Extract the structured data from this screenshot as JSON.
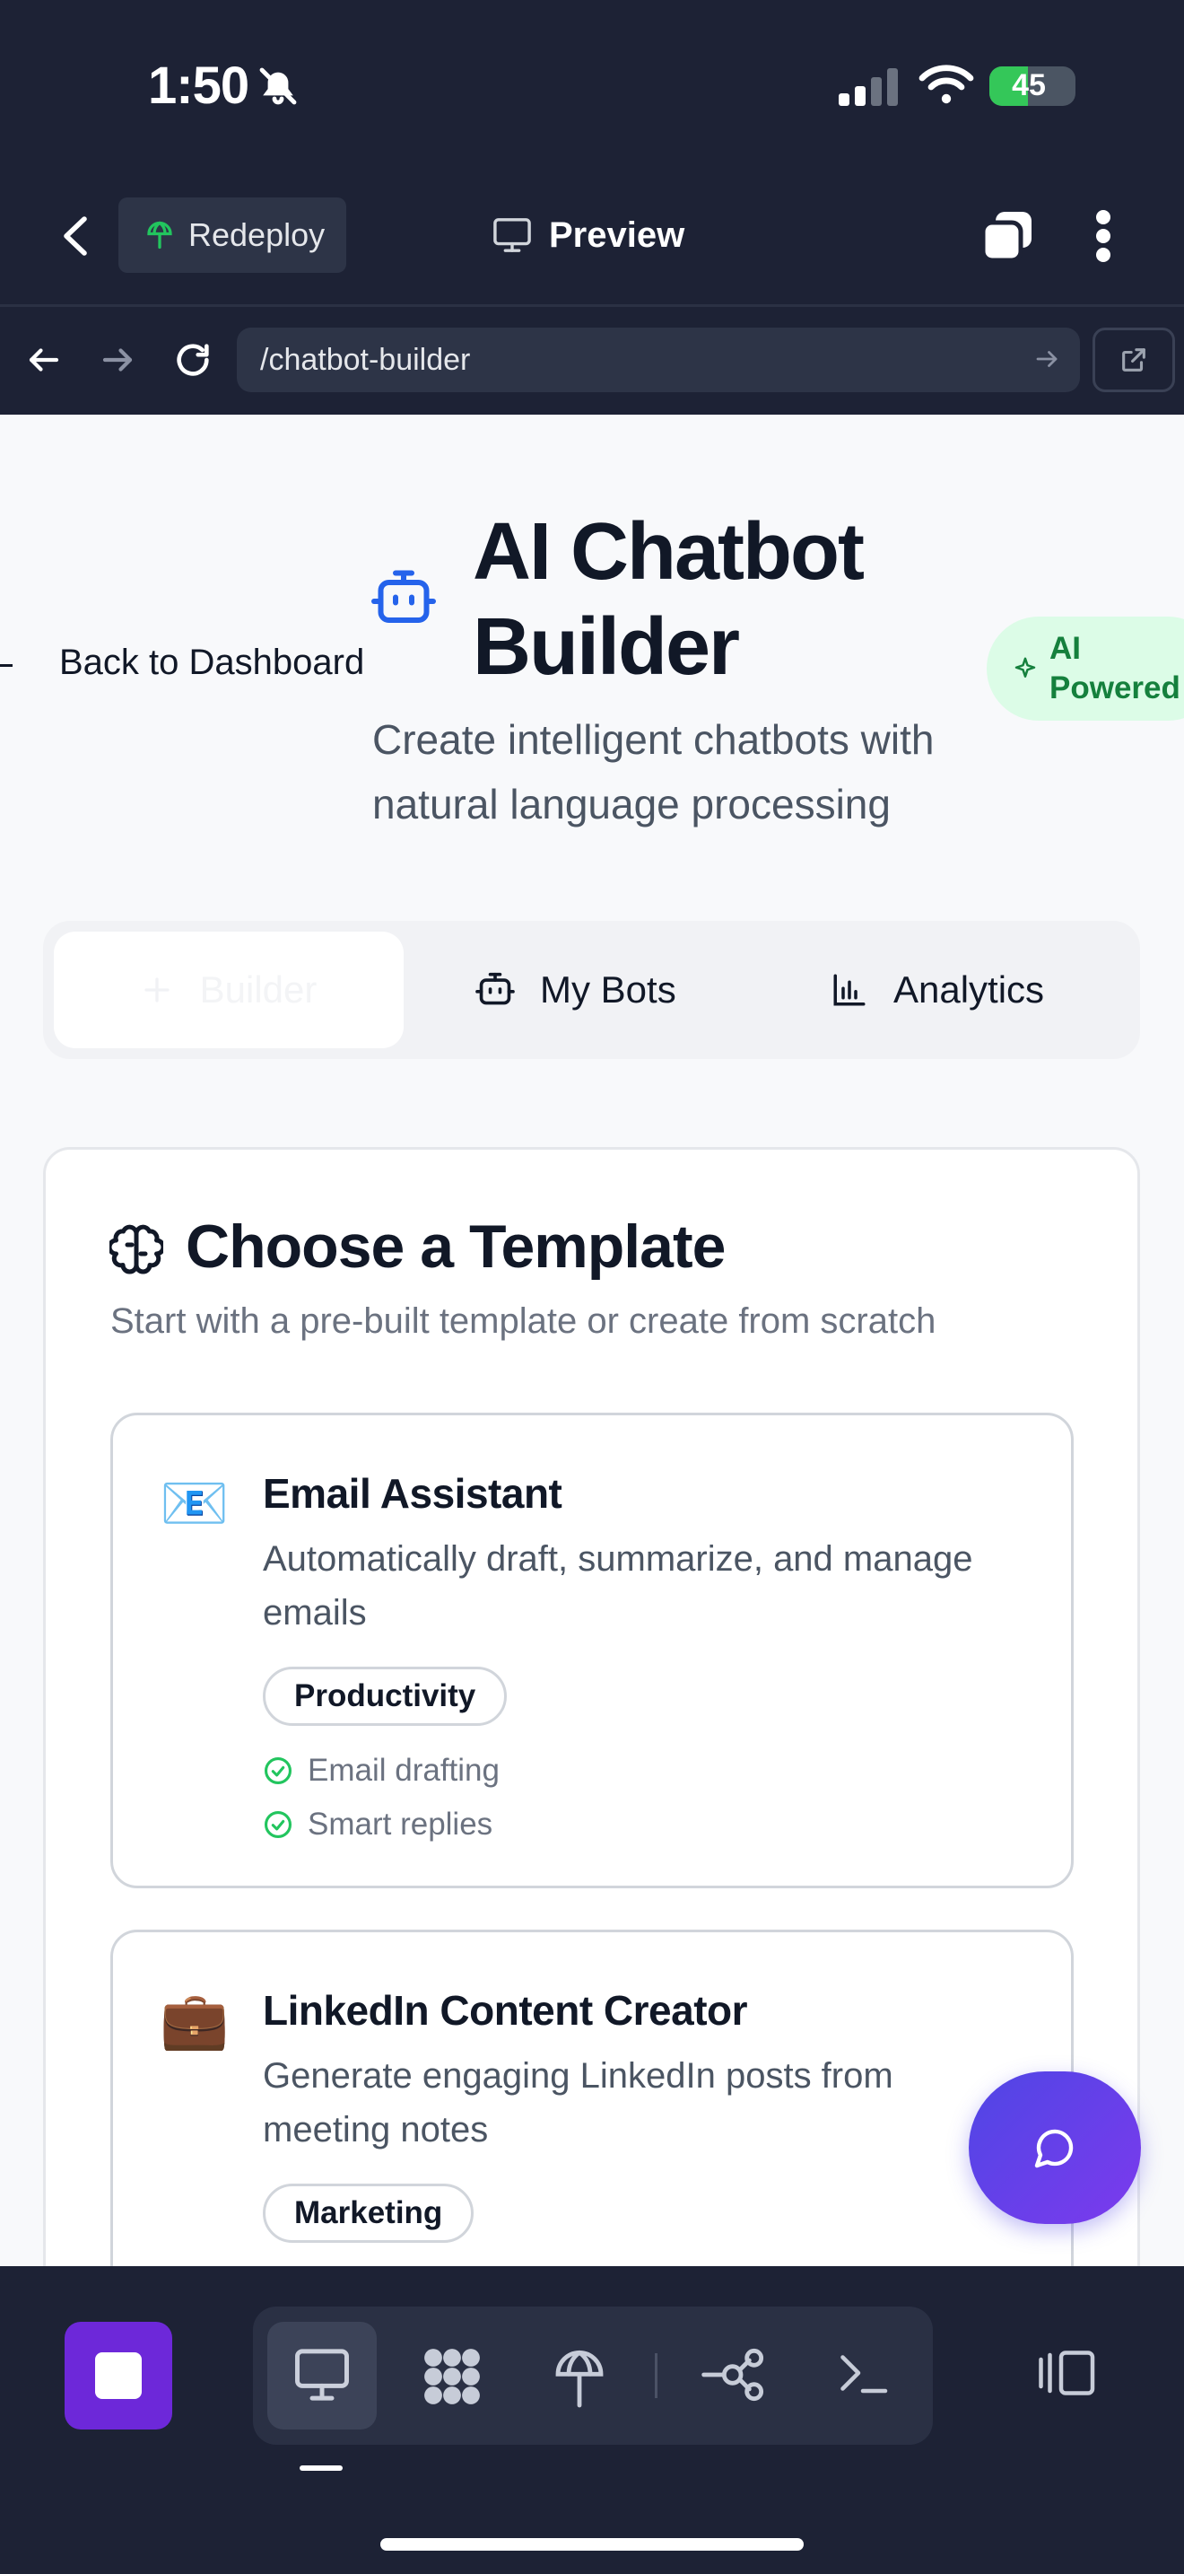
{
  "status_bar": {
    "time": "1:50",
    "battery": "45",
    "battery_level": 0.45
  },
  "top_bar": {
    "redeploy_label": "Redeploy",
    "preview_label": "Preview"
  },
  "url_bar": {
    "url": "/chatbot-builder"
  },
  "page": {
    "back_label": "Back to Dashboard",
    "title": "AI Chatbot Builder",
    "badge": "AI Powered",
    "subtitle": "Create intelligent chatbots with natural language processing",
    "tabs": [
      {
        "label": "Builder",
        "active": true
      },
      {
        "label": "My Bots",
        "active": false
      },
      {
        "label": "Analytics",
        "active": false
      }
    ],
    "section": {
      "title": "Choose a Template",
      "subtitle": "Start with a pre-built template or create from scratch"
    },
    "templates": [
      {
        "icon": "📧",
        "name": "Email Assistant",
        "description": "Automatically draft, summarize, and manage emails",
        "tag": "Productivity",
        "features": [
          "Email drafting",
          "Smart replies"
        ]
      },
      {
        "icon": "💼",
        "name": "LinkedIn Content Creator",
        "description": "Generate engaging LinkedIn posts from meeting notes",
        "tag": "Marketing",
        "features": []
      }
    ]
  },
  "colors": {
    "accent": "#4f46e5",
    "success": "#22c55e",
    "chrome_bg": "#1d2235"
  }
}
